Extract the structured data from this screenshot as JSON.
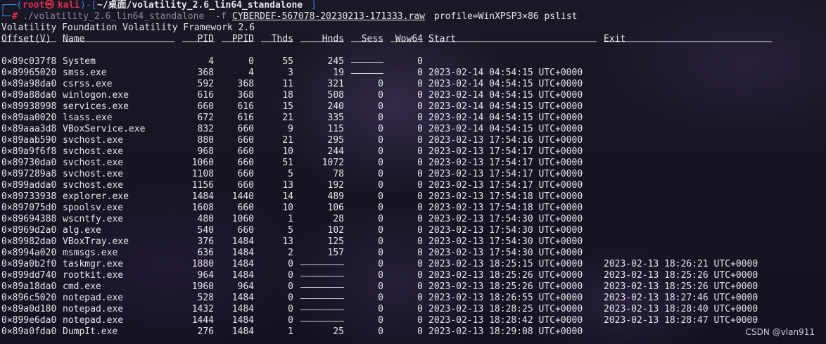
{
  "prompt": {
    "user": "root",
    "at_symbol": "㉿",
    "host": "kali",
    "dir": "~/桌面/volatility_2.6_lin64_standalone",
    "command": "./volatility_2.6_lin64_standalone",
    "flag": "-f",
    "file": "CYBERDEF-567078-20230213-171333.raw",
    "args": "profile=WinXPSP3×86 pslist"
  },
  "banner": "Volatility Foundation Volatility Framework 2.6",
  "columns": {
    "offset": "Offset(V)",
    "name": "Name",
    "pid": "PID",
    "ppid": "PPID",
    "thds": "Thds",
    "hnds": "Hnds",
    "sess": "Sess",
    "wow64": "Wow64",
    "start": "Start",
    "exit": "Exit"
  },
  "rows": [
    {
      "offset": "0×89c037f8",
      "name": "System",
      "pid": "4",
      "ppid": "0",
      "thds": "55",
      "hnds": "245",
      "sess": "——————",
      "wow64": "0",
      "start": "",
      "exit": ""
    },
    {
      "offset": "0×89965020",
      "name": "smss.exe",
      "pid": "368",
      "ppid": "4",
      "thds": "3",
      "hnds": "19",
      "sess": "——————",
      "wow64": "0",
      "start": "2023-02-14 04:54:15 UTC+0000",
      "exit": ""
    },
    {
      "offset": "0×89a98da0",
      "name": "csrss.exe",
      "pid": "592",
      "ppid": "368",
      "thds": "11",
      "hnds": "321",
      "sess": "0",
      "wow64": "0",
      "start": "2023-02-14 04:54:15 UTC+0000",
      "exit": ""
    },
    {
      "offset": "0×89a88da0",
      "name": "winlogon.exe",
      "pid": "616",
      "ppid": "368",
      "thds": "18",
      "hnds": "508",
      "sess": "0",
      "wow64": "0",
      "start": "2023-02-14 04:54:15 UTC+0000",
      "exit": ""
    },
    {
      "offset": "0×89938998",
      "name": "services.exe",
      "pid": "660",
      "ppid": "616",
      "thds": "15",
      "hnds": "240",
      "sess": "0",
      "wow64": "0",
      "start": "2023-02-14 04:54:15 UTC+0000",
      "exit": ""
    },
    {
      "offset": "0×89aa0020",
      "name": "lsass.exe",
      "pid": "672",
      "ppid": "616",
      "thds": "21",
      "hnds": "335",
      "sess": "0",
      "wow64": "0",
      "start": "2023-02-14 04:54:15 UTC+0000",
      "exit": ""
    },
    {
      "offset": "0×89aaa3d8",
      "name": "VBoxService.exe",
      "pid": "832",
      "ppid": "660",
      "thds": "9",
      "hnds": "115",
      "sess": "0",
      "wow64": "0",
      "start": "2023-02-14 04:54:15 UTC+0000",
      "exit": ""
    },
    {
      "offset": "0×89aab590",
      "name": "svchost.exe",
      "pid": "880",
      "ppid": "660",
      "thds": "21",
      "hnds": "295",
      "sess": "0",
      "wow64": "0",
      "start": "2023-02-13 17:54:16 UTC+0000",
      "exit": ""
    },
    {
      "offset": "0×89a9f6f8",
      "name": "svchost.exe",
      "pid": "968",
      "ppid": "660",
      "thds": "10",
      "hnds": "244",
      "sess": "0",
      "wow64": "0",
      "start": "2023-02-13 17:54:17 UTC+0000",
      "exit": ""
    },
    {
      "offset": "0×89730da0",
      "name": "svchost.exe",
      "pid": "1060",
      "ppid": "660",
      "thds": "51",
      "hnds": "1072",
      "sess": "0",
      "wow64": "0",
      "start": "2023-02-13 17:54:17 UTC+0000",
      "exit": ""
    },
    {
      "offset": "0×897289a8",
      "name": "svchost.exe",
      "pid": "1108",
      "ppid": "660",
      "thds": "5",
      "hnds": "78",
      "sess": "0",
      "wow64": "0",
      "start": "2023-02-13 17:54:17 UTC+0000",
      "exit": ""
    },
    {
      "offset": "0×899adda0",
      "name": "svchost.exe",
      "pid": "1156",
      "ppid": "660",
      "thds": "13",
      "hnds": "192",
      "sess": "0",
      "wow64": "0",
      "start": "2023-02-13 17:54:17 UTC+0000",
      "exit": ""
    },
    {
      "offset": "0×89733938",
      "name": "explorer.exe",
      "pid": "1484",
      "ppid": "1440",
      "thds": "14",
      "hnds": "489",
      "sess": "0",
      "wow64": "0",
      "start": "2023-02-13 17:54:18 UTC+0000",
      "exit": ""
    },
    {
      "offset": "0×897075d0",
      "name": "spoolsv.exe",
      "pid": "1608",
      "ppid": "660",
      "thds": "10",
      "hnds": "106",
      "sess": "0",
      "wow64": "0",
      "start": "2023-02-13 17:54:18 UTC+0000",
      "exit": ""
    },
    {
      "offset": "0×89694388",
      "name": "wscntfy.exe",
      "pid": "480",
      "ppid": "1060",
      "thds": "1",
      "hnds": "28",
      "sess": "0",
      "wow64": "0",
      "start": "2023-02-13 17:54:30 UTC+0000",
      "exit": ""
    },
    {
      "offset": "0×8969d2a0",
      "name": "alg.exe",
      "pid": "540",
      "ppid": "660",
      "thds": "5",
      "hnds": "102",
      "sess": "0",
      "wow64": "0",
      "start": "2023-02-13 17:54:30 UTC+0000",
      "exit": ""
    },
    {
      "offset": "0×89982da0",
      "name": "VBoxTray.exe",
      "pid": "376",
      "ppid": "1484",
      "thds": "13",
      "hnds": "125",
      "sess": "0",
      "wow64": "0",
      "start": "2023-02-13 17:54:30 UTC+0000",
      "exit": ""
    },
    {
      "offset": "0×8994a020",
      "name": "msmsgs.exe",
      "pid": "636",
      "ppid": "1484",
      "thds": "2",
      "hnds": "157",
      "sess": "0",
      "wow64": "0",
      "start": "2023-02-13 17:54:30 UTC+0000",
      "exit": ""
    },
    {
      "offset": "0×89a0b2f0",
      "name": "taskmgr.exe",
      "pid": "1880",
      "ppid": "1484",
      "thds": "0",
      "hnds": "——————",
      "sess": "0",
      "wow64": "0",
      "start": "2023-02-13 18:25:15 UTC+0000",
      "exit": "2023-02-13 18:26:21 UTC+0000"
    },
    {
      "offset": "0×899dd740",
      "name": "rootkit.exe",
      "pid": "964",
      "ppid": "1484",
      "thds": "0",
      "hnds": "——————",
      "sess": "0",
      "wow64": "0",
      "start": "2023-02-13 18:25:26 UTC+0000",
      "exit": "2023-02-13 18:25:26 UTC+0000"
    },
    {
      "offset": "0×89a18da0",
      "name": "cmd.exe",
      "pid": "1960",
      "ppid": "964",
      "thds": "0",
      "hnds": "——————",
      "sess": "0",
      "wow64": "0",
      "start": "2023-02-13 18:25:26 UTC+0000",
      "exit": "2023-02-13 18:25:26 UTC+0000"
    },
    {
      "offset": "0×896c5020",
      "name": "notepad.exe",
      "pid": "528",
      "ppid": "1484",
      "thds": "0",
      "hnds": "——————",
      "sess": "0",
      "wow64": "0",
      "start": "2023-02-13 18:26:55 UTC+0000",
      "exit": "2023-02-13 18:27:46 UTC+0000"
    },
    {
      "offset": "0×89a0d180",
      "name": "notepad.exe",
      "pid": "1432",
      "ppid": "1484",
      "thds": "0",
      "hnds": "——————",
      "sess": "0",
      "wow64": "0",
      "start": "2023-02-13 18:28:25 UTC+0000",
      "exit": "2023-02-13 18:28:40 UTC+0000"
    },
    {
      "offset": "0×899e6da0",
      "name": "notepad.exe",
      "pid": "1444",
      "ppid": "1484",
      "thds": "0",
      "hnds": "——————",
      "sess": "0",
      "wow64": "0",
      "start": "2023-02-13 18:28:42 UTC+0000",
      "exit": "2023-02-13 18:28:47 UTC+0000"
    },
    {
      "offset": "0×89a0fda0",
      "name": "DumpIt.exe",
      "pid": "276",
      "ppid": "1484",
      "thds": "1",
      "hnds": "25",
      "sess": "0",
      "wow64": "0",
      "start": "2023-02-13 18:29:08 UTC+0000",
      "exit": ""
    }
  ],
  "watermark": "CSDN @vlan911"
}
